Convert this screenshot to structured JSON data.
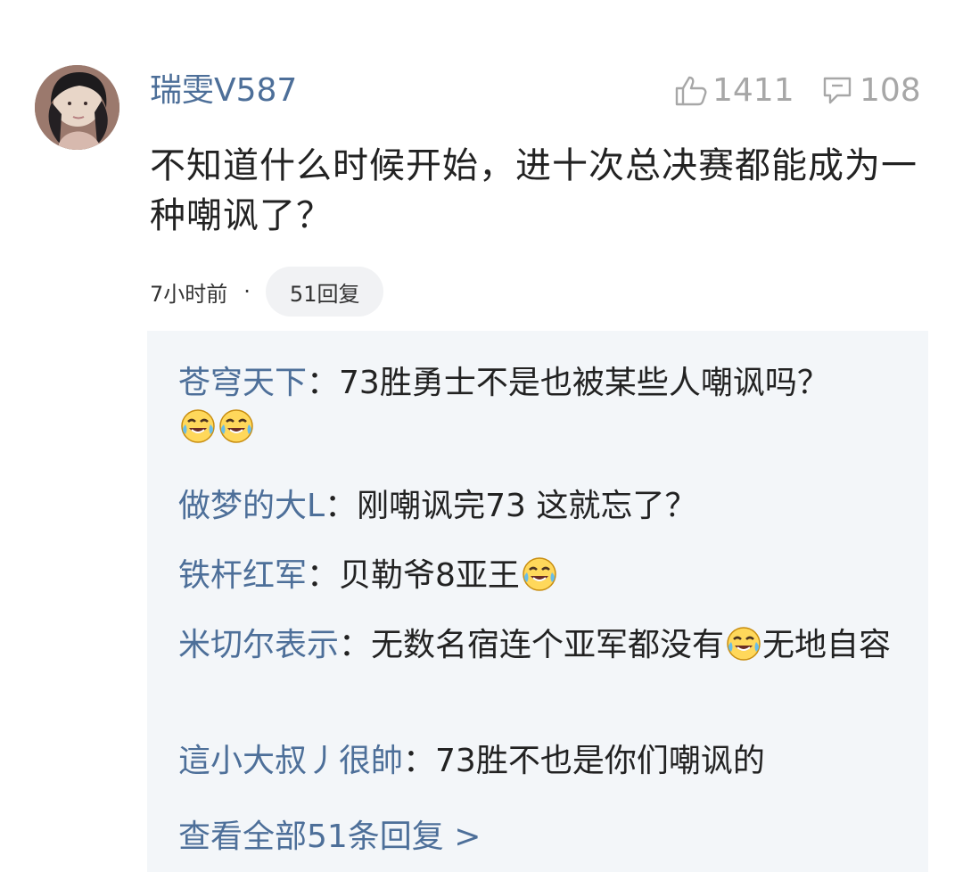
{
  "comment": {
    "author": "瑞雯V587",
    "likes": "1411",
    "replies_count": "108",
    "text": "不知道什么时候开始，进十次总决赛都能成为一种嘲讽了？",
    "time": "7小时前",
    "separator": "·",
    "reply_button": "51回复"
  },
  "replies": {
    "items": [
      {
        "name": "苍穹天下",
        "colon": "：",
        "text": "73胜勇士不是也被某些人嘲讽吗？",
        "emoji": "tears-of-joy-emoji"
      },
      {
        "name": "做梦的大L",
        "colon": "：",
        "text": "刚嘲讽完73 这就忘了？"
      },
      {
        "name": "铁杆红军",
        "colon": "：",
        "text": "贝勒爷8亚王",
        "emoji": "tears-of-joy-emoji"
      },
      {
        "name": "米切尔表示",
        "colon": "：",
        "text_before": "无数名宿连个亚军都没有",
        "text_after": "无地自容",
        "emoji": "tears-of-joy-emoji"
      },
      {
        "name": "這小大叔丿很帥",
        "colon": "：",
        "text": "73胜不也是你们嘲讽的"
      }
    ],
    "view_all": "查看全部51条回复 >"
  },
  "icons": {
    "like": "thumbs-up-outline-icon",
    "reply": "comment-bubble-icon"
  },
  "colors": {
    "link": "#4d6f99",
    "muted": "#a7a7a7",
    "reply_panel": "#f3f6f9",
    "pill": "#f1f2f4"
  }
}
